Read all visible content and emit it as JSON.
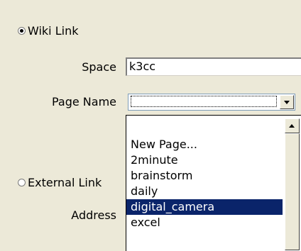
{
  "wiki_link": {
    "label": "Wiki Link",
    "selected": true
  },
  "space": {
    "label": "Space",
    "value": "k3cc"
  },
  "page_name": {
    "label": "Page Name",
    "value": ""
  },
  "external_link": {
    "label": "External Link",
    "selected": false
  },
  "address": {
    "label": "Address"
  },
  "dropdown": {
    "items": [
      "New Page...",
      "2minute",
      "brainstorm",
      "daily",
      "digital_camera",
      "excel"
    ],
    "selected_item": "digital_camera"
  },
  "colors": {
    "selection": "#0a246a",
    "background": "#ece9d8"
  }
}
